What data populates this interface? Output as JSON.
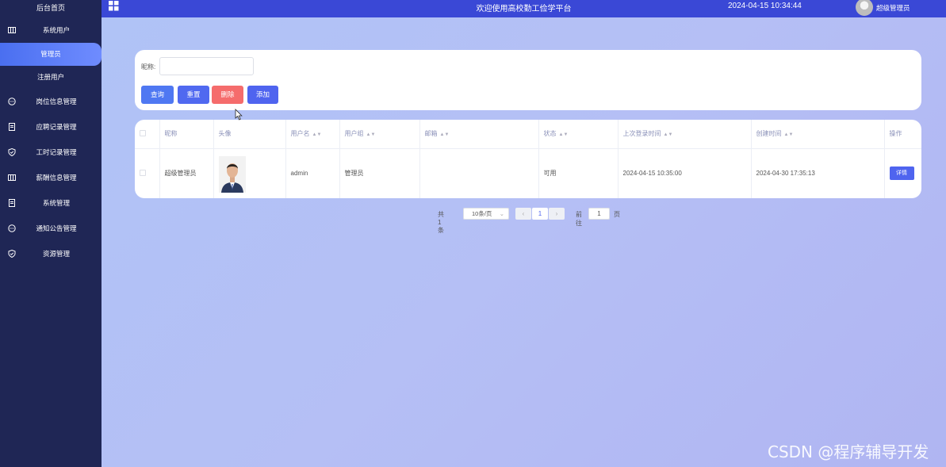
{
  "sidebar": {
    "home": "后台首页",
    "group_users": "系统用户",
    "sub_admin": "管理员",
    "sub_users": "注册用户",
    "items": [
      "岗位信息管理",
      "应聘记录管理",
      "工时记录管理",
      "薪酬信息管理",
      "系统管理",
      "通知公告管理",
      "资源管理"
    ]
  },
  "header": {
    "welcome": "欢迎使用高校勤工俭学平台",
    "datetime": "2024-04-15 10:34:44",
    "user": "超级管理员"
  },
  "search": {
    "label": "昵称:",
    "value": "",
    "buttons": {
      "query": "查询",
      "reset": "重置",
      "delete": "删除",
      "add": "添加"
    }
  },
  "table": {
    "headers": [
      "昵称",
      "头像",
      "用户名",
      "用户组",
      "邮箱",
      "状态",
      "上次登录时间",
      "创建时间",
      "操作"
    ],
    "row": {
      "nickname": "超级管理员",
      "username": "admin",
      "group": "管理员",
      "email": "",
      "status": "可用",
      "last_login": "2024-04-15 10:35:00",
      "created": "2024-04-30 17:35:13",
      "action": "详情"
    }
  },
  "pager": {
    "total": "共 1 条",
    "page_size": "10条/页",
    "prev": "‹",
    "current": "1",
    "next": "›",
    "goto": "前往",
    "goto_value": "1",
    "page_suffix": "页"
  },
  "watermark": "CSDN @程序辅导开发"
}
